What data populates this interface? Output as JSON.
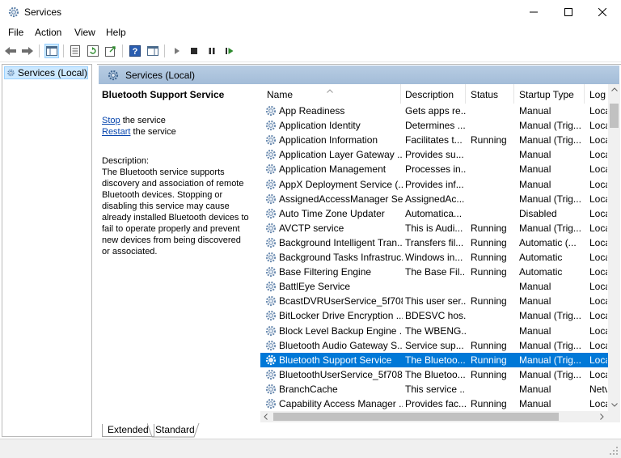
{
  "window": {
    "title": "Services"
  },
  "menu": [
    "File",
    "Action",
    "View",
    "Help"
  ],
  "tree": {
    "item": "Services (Local)"
  },
  "panel": {
    "title": "Services (Local)"
  },
  "details": {
    "service_name": "Bluetooth Support Service",
    "stop_link": "Stop",
    "stop_suffix": " the service",
    "restart_link": "Restart",
    "restart_suffix": " the service",
    "desc_label": "Description:",
    "desc_lines": [
      "The Bluetooth service supports",
      "discovery and association of remote",
      "Bluetooth devices.  Stopping or",
      "disabling this service may cause",
      "already installed Bluetooth devices to",
      "fail to operate properly and prevent",
      "new devices from being discovered",
      "or associated."
    ]
  },
  "columns": {
    "name": "Name",
    "description": "Description",
    "status": "Status",
    "startup": "Startup Type",
    "log": "Log"
  },
  "rows": [
    {
      "name": "App Readiness",
      "desc": "Gets apps re...",
      "status": "",
      "startup": "Manual",
      "log": "Loca"
    },
    {
      "name": "Application Identity",
      "desc": "Determines ...",
      "status": "",
      "startup": "Manual (Trig...",
      "log": "Loca"
    },
    {
      "name": "Application Information",
      "desc": "Facilitates t...",
      "status": "Running",
      "startup": "Manual (Trig...",
      "log": "Loca"
    },
    {
      "name": "Application Layer Gateway ...",
      "desc": "Provides su...",
      "status": "",
      "startup": "Manual",
      "log": "Loca"
    },
    {
      "name": "Application Management",
      "desc": "Processes in...",
      "status": "",
      "startup": "Manual",
      "log": "Loca"
    },
    {
      "name": "AppX Deployment Service (...",
      "desc": "Provides inf...",
      "status": "",
      "startup": "Manual",
      "log": "Loca"
    },
    {
      "name": "AssignedAccessManager Se...",
      "desc": "AssignedAc...",
      "status": "",
      "startup": "Manual (Trig...",
      "log": "Loca"
    },
    {
      "name": "Auto Time Zone Updater",
      "desc": "Automatica...",
      "status": "",
      "startup": "Disabled",
      "log": "Loca"
    },
    {
      "name": "AVCTP service",
      "desc": "This is Audi...",
      "status": "Running",
      "startup": "Manual (Trig...",
      "log": "Loca"
    },
    {
      "name": "Background Intelligent Tran...",
      "desc": "Transfers fil...",
      "status": "Running",
      "startup": "Automatic (...",
      "log": "Loca"
    },
    {
      "name": "Background Tasks Infrastruc...",
      "desc": "Windows in...",
      "status": "Running",
      "startup": "Automatic",
      "log": "Loca"
    },
    {
      "name": "Base Filtering Engine",
      "desc": "The Base Fil...",
      "status": "Running",
      "startup": "Automatic",
      "log": "Loca"
    },
    {
      "name": "BattlEye Service",
      "desc": "",
      "status": "",
      "startup": "Manual",
      "log": "Loca"
    },
    {
      "name": "BcastDVRUserService_5f708",
      "desc": "This user ser...",
      "status": "Running",
      "startup": "Manual",
      "log": "Loca"
    },
    {
      "name": "BitLocker Drive Encryption ...",
      "desc": "BDESVC hos...",
      "status": "",
      "startup": "Manual (Trig...",
      "log": "Loca"
    },
    {
      "name": "Block Level Backup Engine ...",
      "desc": "The WBENG...",
      "status": "",
      "startup": "Manual",
      "log": "Loca"
    },
    {
      "name": "Bluetooth Audio Gateway S...",
      "desc": "Service sup...",
      "status": "Running",
      "startup": "Manual (Trig...",
      "log": "Loca"
    },
    {
      "name": "Bluetooth Support Service",
      "desc": "The Bluetoo...",
      "status": "Running",
      "startup": "Manual (Trig...",
      "log": "Loca",
      "selected": true
    },
    {
      "name": "BluetoothUserService_5f708",
      "desc": "The Bluetoo...",
      "status": "Running",
      "startup": "Manual (Trig...",
      "log": "Loca"
    },
    {
      "name": "BranchCache",
      "desc": "This service ...",
      "status": "",
      "startup": "Manual",
      "log": "Netv"
    },
    {
      "name": "Capability Access Manager ...",
      "desc": "Provides fac...",
      "status": "Running",
      "startup": "Manual",
      "log": "Loca"
    }
  ],
  "tabs": {
    "extended": "Extended",
    "standard": "Standard"
  },
  "colors": {
    "selection": "#0078d7",
    "panel_header": "#a3bcd8",
    "link": "#0645ad"
  }
}
